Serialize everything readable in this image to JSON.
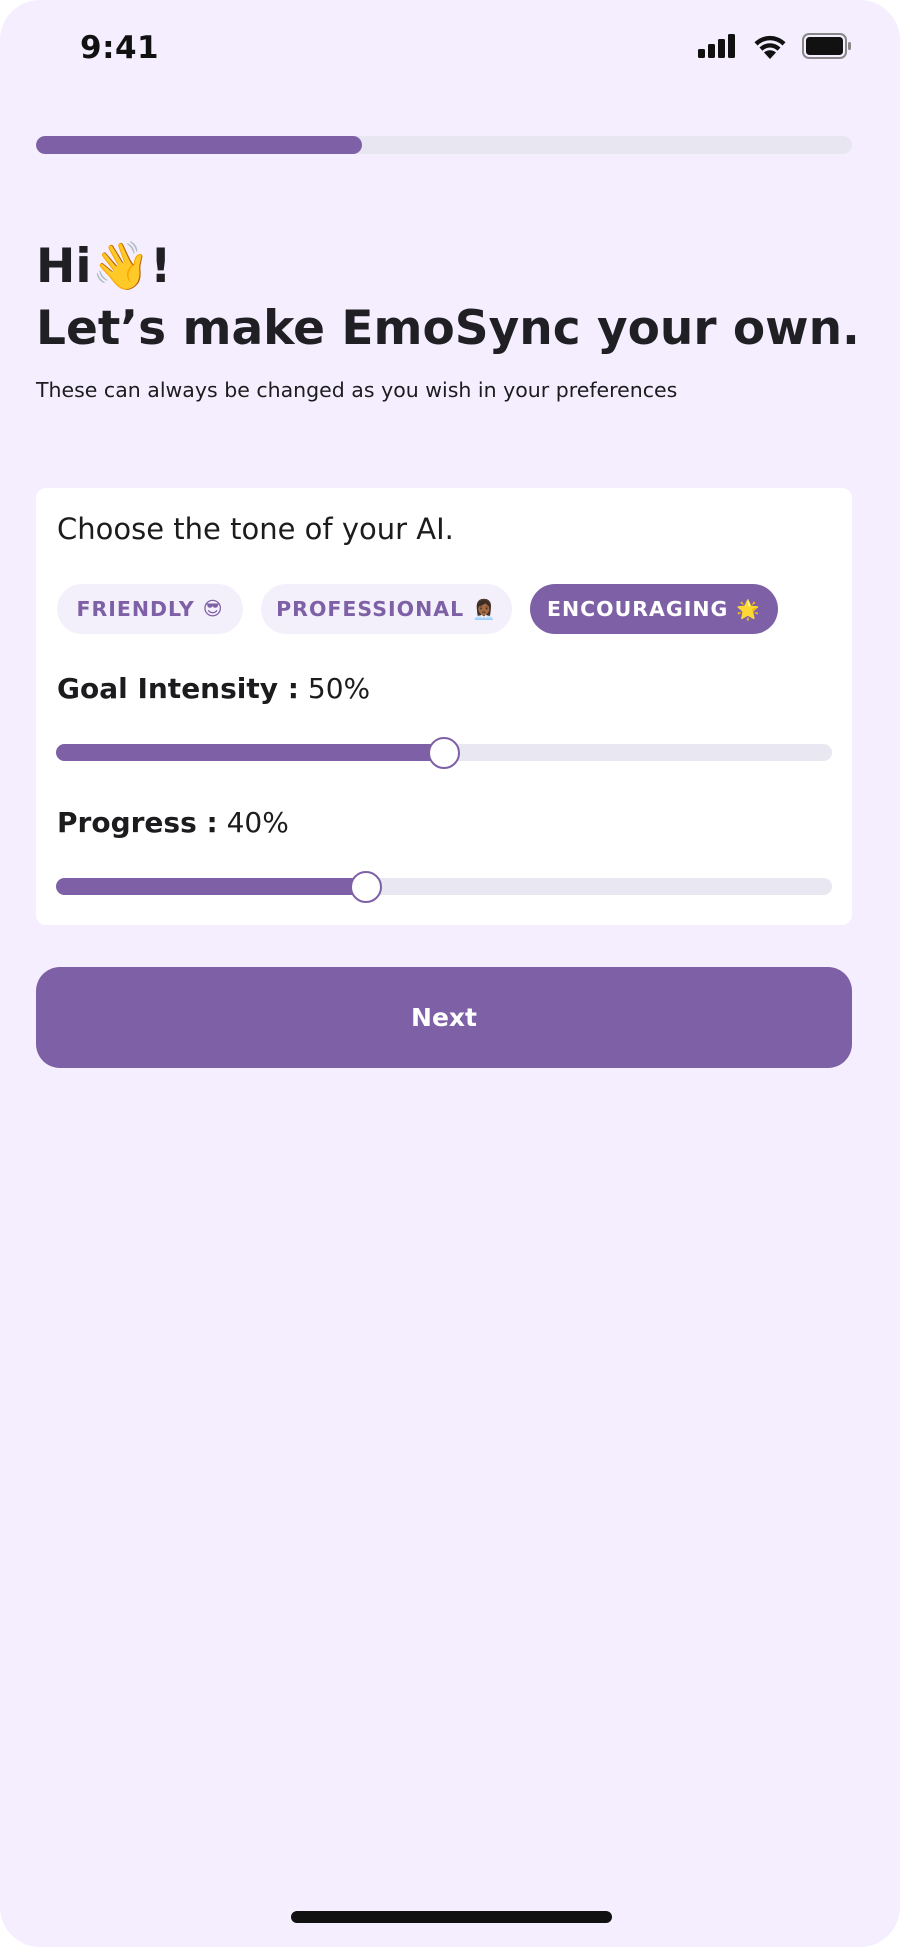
{
  "status_bar": {
    "time": "9:41",
    "icons": [
      "cellular-signal-icon",
      "wifi-icon",
      "battery-icon"
    ]
  },
  "onboarding_progress": {
    "fraction": 0.4
  },
  "header": {
    "greeting": "Hi👋!",
    "title": "Let’s make EmoSync your own.",
    "subtitle": "These can always be changed as you wish in your preferences"
  },
  "card": {
    "question": "Choose the tone of your AI.",
    "tones": [
      {
        "label": "FRIENDLY",
        "emoji": "😎",
        "selected": false
      },
      {
        "label": "PROFESSIONAL",
        "emoji": "👩🏾‍💼",
        "selected": false
      },
      {
        "label": "ENCOURAGING",
        "emoji": "🌟",
        "selected": true
      }
    ],
    "goal_intensity": {
      "label": "Goal Intensity :",
      "value_text": "50%",
      "value": 0.5
    },
    "progress": {
      "label": "Progress  :",
      "value_text": "40%",
      "value": 0.4
    }
  },
  "next_button": {
    "label": "Next"
  },
  "colors": {
    "accent": "#7e60a6",
    "background": "#f4eefe",
    "track": "#e9e7f1",
    "card": "#ffffff"
  }
}
